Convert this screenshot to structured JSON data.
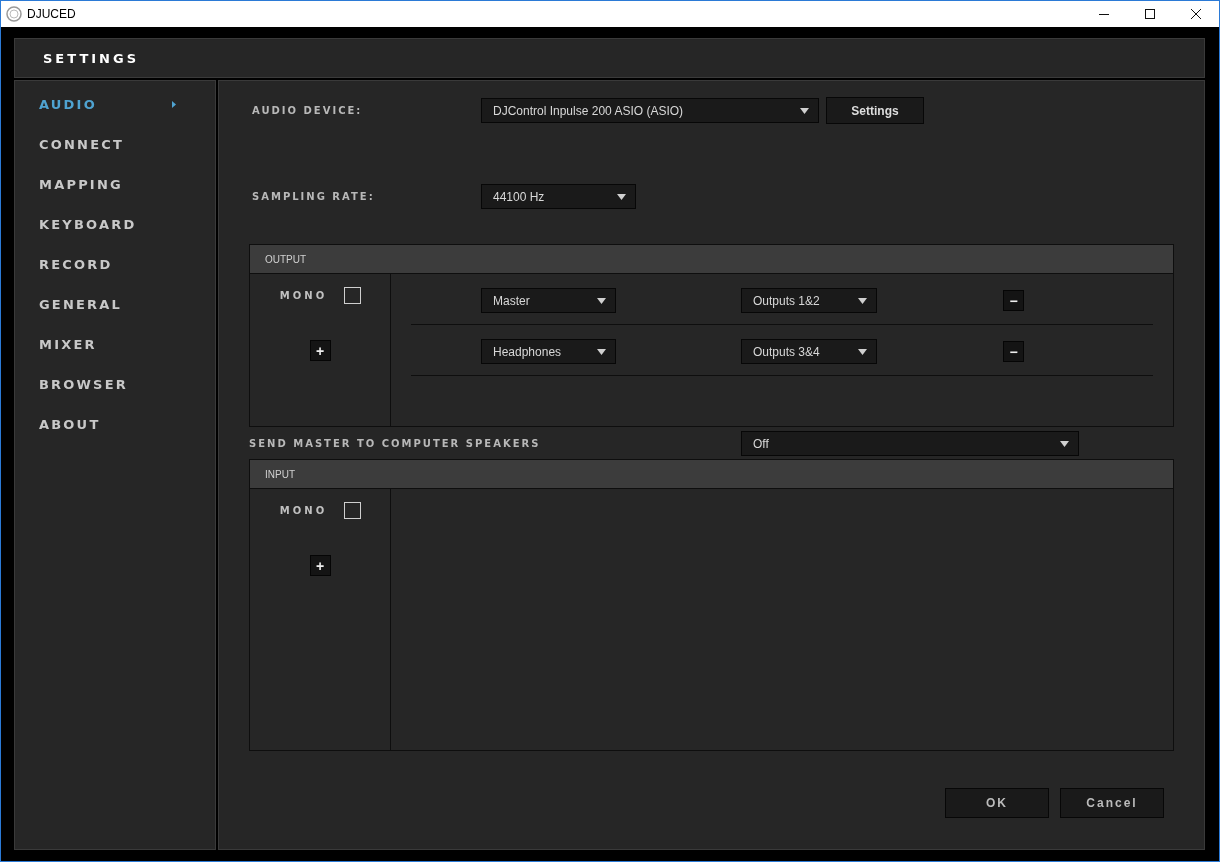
{
  "window": {
    "title": "DJUCED"
  },
  "header": {
    "title": "SETTINGS"
  },
  "sidebar": {
    "items": [
      {
        "label": "AUDIO",
        "selected": true
      },
      {
        "label": "CONNECT",
        "selected": false
      },
      {
        "label": "MAPPING",
        "selected": false
      },
      {
        "label": "KEYBOARD",
        "selected": false
      },
      {
        "label": "RECORD",
        "selected": false
      },
      {
        "label": "GENERAL",
        "selected": false
      },
      {
        "label": "MIXER",
        "selected": false
      },
      {
        "label": "BROWSER",
        "selected": false
      },
      {
        "label": "ABOUT",
        "selected": false
      }
    ]
  },
  "audio_device": {
    "label": "AUDIO DEVICE:",
    "value": "DJControl Inpulse 200 ASIO (ASIO)",
    "button": "Settings"
  },
  "sampling_rate": {
    "label": "SAMPLING RATE:",
    "value": "44100 Hz"
  },
  "output": {
    "title": "OUTPUT",
    "mono": {
      "label": "MONO",
      "checked": false
    },
    "add": "+",
    "routes": [
      {
        "channel": "Master",
        "outputs": "Outputs 1&2",
        "remove": "−"
      },
      {
        "channel": "Headphones",
        "outputs": "Outputs 3&4",
        "remove": "−"
      }
    ]
  },
  "send_master": {
    "label": "SEND MASTER TO COMPUTER SPEAKERS",
    "value": "Off"
  },
  "input": {
    "title": "INPUT",
    "mono": {
      "label": "MONO",
      "checked": false
    },
    "add": "+"
  },
  "buttons": [
    {
      "label": "OK"
    },
    {
      "label": "Cancel"
    }
  ]
}
